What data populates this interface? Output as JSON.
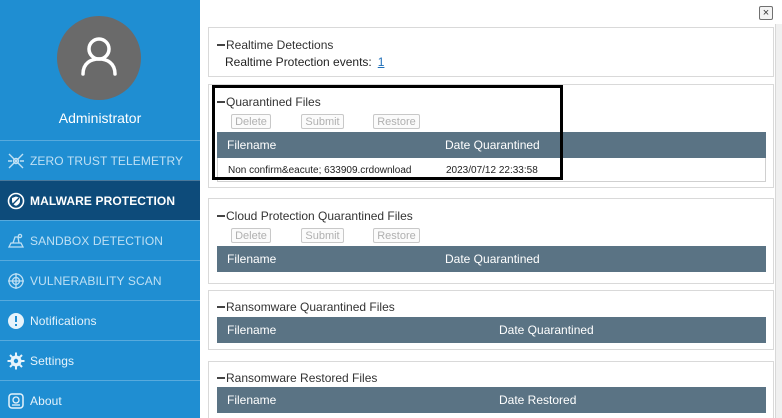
{
  "sidebar": {
    "user_name": "Administrator",
    "items": [
      {
        "label": "ZERO TRUST TELEMETRY",
        "icon": "zero-trust-icon"
      },
      {
        "label": "MALWARE PROTECTION",
        "icon": "malware-shield-icon",
        "active": true
      },
      {
        "label": "SANDBOX DETECTION",
        "icon": "sandbox-icon"
      },
      {
        "label": "VULNERABILITY SCAN",
        "icon": "vulnerability-icon"
      },
      {
        "label": "Notifications",
        "icon": "info-icon"
      },
      {
        "label": "Settings",
        "icon": "gear-icon"
      },
      {
        "label": "About",
        "icon": "about-icon"
      }
    ]
  },
  "main": {
    "close_label": "×",
    "realtime": {
      "title": "Realtime Detections",
      "events_label": "Realtime Protection events:",
      "events_count": "1"
    },
    "quarantined": {
      "title": "Quarantined Files",
      "buttons": {
        "delete": "Delete",
        "submit": "Submit",
        "restore": "Restore"
      },
      "columns": [
        "Filename",
        "Date Quarantined"
      ],
      "rows": [
        {
          "filename": "Non confirm&eacute; 633909.crdownload",
          "date": "2023/07/12 22:33:58"
        }
      ]
    },
    "cloud": {
      "title": "Cloud Protection Quarantined Files",
      "buttons": {
        "delete": "Delete",
        "submit": "Submit",
        "restore": "Restore"
      },
      "columns": [
        "Filename",
        "Date Quarantined"
      ]
    },
    "ransomware_quarantined": {
      "title": "Ransomware Quarantined Files",
      "columns": [
        "Filename",
        "Date Quarantined"
      ]
    },
    "ransomware_restored": {
      "title": "Ransomware Restored Files",
      "columns": [
        "Filename",
        "Date Restored"
      ]
    }
  },
  "colors": {
    "sidebar_bg": "#1f8ed2",
    "sidebar_active": "#0d4b7a",
    "table_header": "#5a7384",
    "highlight_box": "#000000"
  }
}
